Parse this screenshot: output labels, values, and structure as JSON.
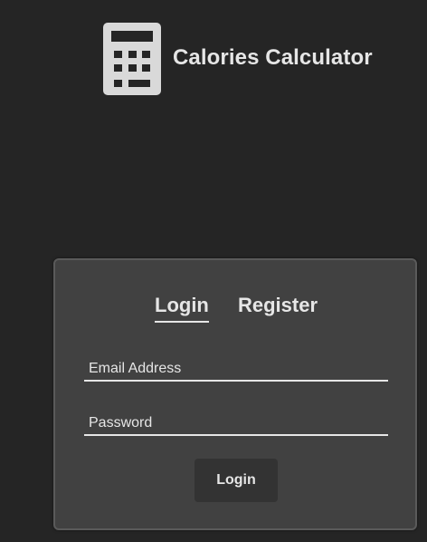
{
  "header": {
    "logo_icon": "calculator-icon",
    "title": "Calories Calculator"
  },
  "auth": {
    "tabs": [
      {
        "label": "Login",
        "active": true
      },
      {
        "label": "Register",
        "active": false
      }
    ],
    "email_placeholder": "Email Address",
    "password_placeholder": "Password",
    "submit_label": "Login"
  },
  "colors": {
    "background": "#252525",
    "card": "#414141",
    "text": "#e6e6e6",
    "button": "#333333"
  }
}
